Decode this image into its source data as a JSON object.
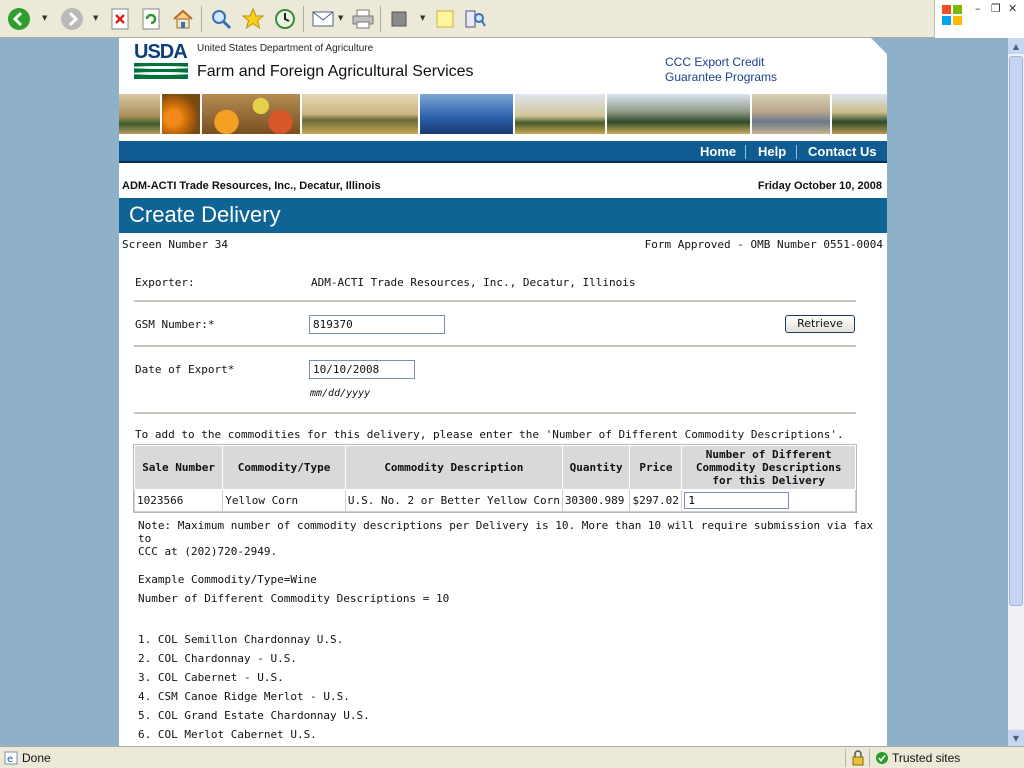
{
  "browser": {
    "toolbar_buttons": [
      "back-icon",
      "forward-icon",
      "stop-icon",
      "refresh-icon",
      "home-icon",
      "search-icon",
      "favorites-icon",
      "history-icon",
      "mail-icon",
      "print-icon",
      "edit-icon",
      "discuss-icon",
      "research-icon"
    ],
    "status_text": "Done",
    "zone_text": "Trusted sites"
  },
  "header": {
    "logo_text": "USDA",
    "department": "United States Department of Agriculture",
    "agency": "Farm and Foreign Agricultural Services",
    "program_line1": "CCC Export Credit",
    "program_line2": "Guarantee Programs"
  },
  "nav": {
    "home": "Home",
    "help": "Help",
    "contact": "Contact Us"
  },
  "info": {
    "firm": "ADM-ACTI Trade Resources, Inc., Decatur, Illinois",
    "date": "Friday October 10, 2008",
    "page_title": "Create Delivery",
    "screen_number": "Screen Number 34",
    "omb": "Form Approved - OMB Number 0551-0004"
  },
  "form": {
    "exporter_label": "Exporter:",
    "exporter_value": "ADM-ACTI Trade Resources, Inc., Decatur, Illinois",
    "gsm_label": "GSM Number:*",
    "gsm_value": "819370",
    "retrieve_label": "Retrieve",
    "date_label": "Date of Export*",
    "date_value": "10/10/2008",
    "date_hint": "mm/dd/yyyy",
    "instruction": "To add to the commodities for this delivery, please enter the 'Number of Different Commodity Descriptions'."
  },
  "table": {
    "headers": [
      "Sale Number",
      "Commodity/Type",
      "Commodity Description",
      "Quantity",
      "Price",
      "Number of Different Commodity Descriptions for this Delivery"
    ],
    "rows": [
      {
        "sale": "1023566",
        "type": "Yellow Corn",
        "desc": "U.S. No. 2 or Better Yellow Corn",
        "qty": "30300.989",
        "price": "$297.02",
        "count": "1"
      }
    ]
  },
  "notes": {
    "note_line1": "Note: Maximum number of commodity descriptions per Delivery is 10. More than 10 will require submission via fax to",
    "note_line2": "CCC at (202)720-2949.",
    "example1": "Example Commodity/Type=Wine",
    "example2": "Number of Different Commodity Descriptions = 10",
    "items": [
      "1. COL Semillon Chardonnay U.S.",
      "2. COL Chardonnay - U.S.",
      "3. COL Cabernet - U.S.",
      "4. CSM Canoe Ridge Merlot - U.S.",
      "5. COL Grand Estate Chardonnay U.S.",
      "6. COL Merlot Cabernet U.S."
    ]
  }
}
